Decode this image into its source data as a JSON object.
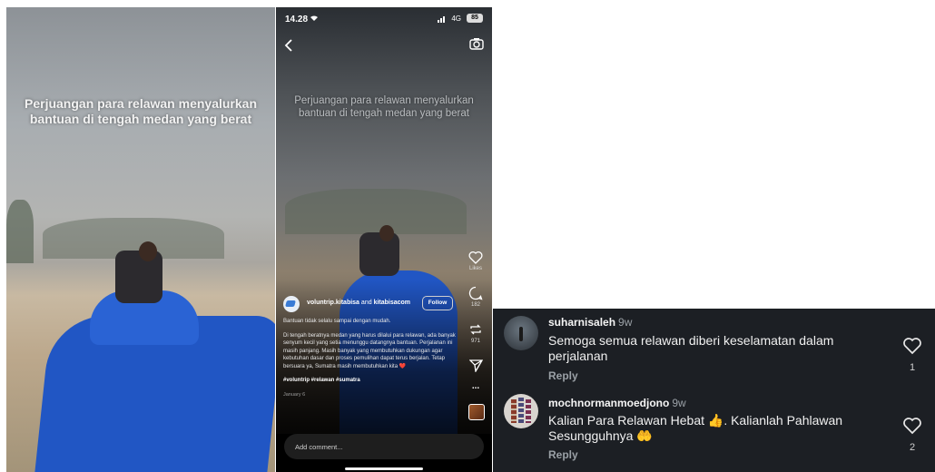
{
  "video": {
    "overlay_caption": "Perjuangan para relawan menyalurkan bantuan di tengah medan yang berat"
  },
  "reel": {
    "status_time": "14.28",
    "network": "4G",
    "battery": "85",
    "likes_label": "Likes",
    "comments_count": "182",
    "reposts_count": "971",
    "more_glyph": "...",
    "account_names": "voluntrip.kitabisa",
    "account_and": "and",
    "account_second": "kitabisacom",
    "follow_label": "Follow",
    "description_line1": "Bantuan tidak selalu sampai dengan mudah.",
    "description_body": "Di tengah beratnya medan yang harus dilalui para relawan, ada banyak senyum kecil yang setia menunggu datangnya bantuan. Perjalanan ini masih panjang. Masih banyak yang membutuhkan dukungan agar kebutuhan dasar dan proses pemulihan dapat terus berjalan. Tetap bersuara ya, Sumatra masih membutuhkan kita ❤️",
    "hashtags": "#voluntrip #relawan #sumatra",
    "date": "January 6",
    "comment_placeholder": "Add comment..."
  },
  "comments": [
    {
      "user": "suharnisaleh",
      "age": "9w",
      "text": "Semoga semua relawan diberi keselamatan dalam perjalanan",
      "reply_label": "Reply",
      "likes": "1"
    },
    {
      "user": "mochnormanmoedjono",
      "age": "9w",
      "text": "Kalian Para Relawan Hebat 👍. Kalianlah Pahlawan Sesungguhnya 🤲",
      "reply_label": "Reply",
      "likes": "2"
    }
  ],
  "icons": [
    "back-arrow-icon",
    "camera-icon",
    "heart-icon",
    "comment-icon",
    "repost-icon",
    "share-icon",
    "more-icon",
    "audio-thumbnail-icon",
    "wifi-icon",
    "signal-icon",
    "battery-icon"
  ],
  "colors": {
    "tarp_blue": "#2156c4",
    "comments_bg": "#1c1f24",
    "muted_text": "#9aa0a6"
  }
}
